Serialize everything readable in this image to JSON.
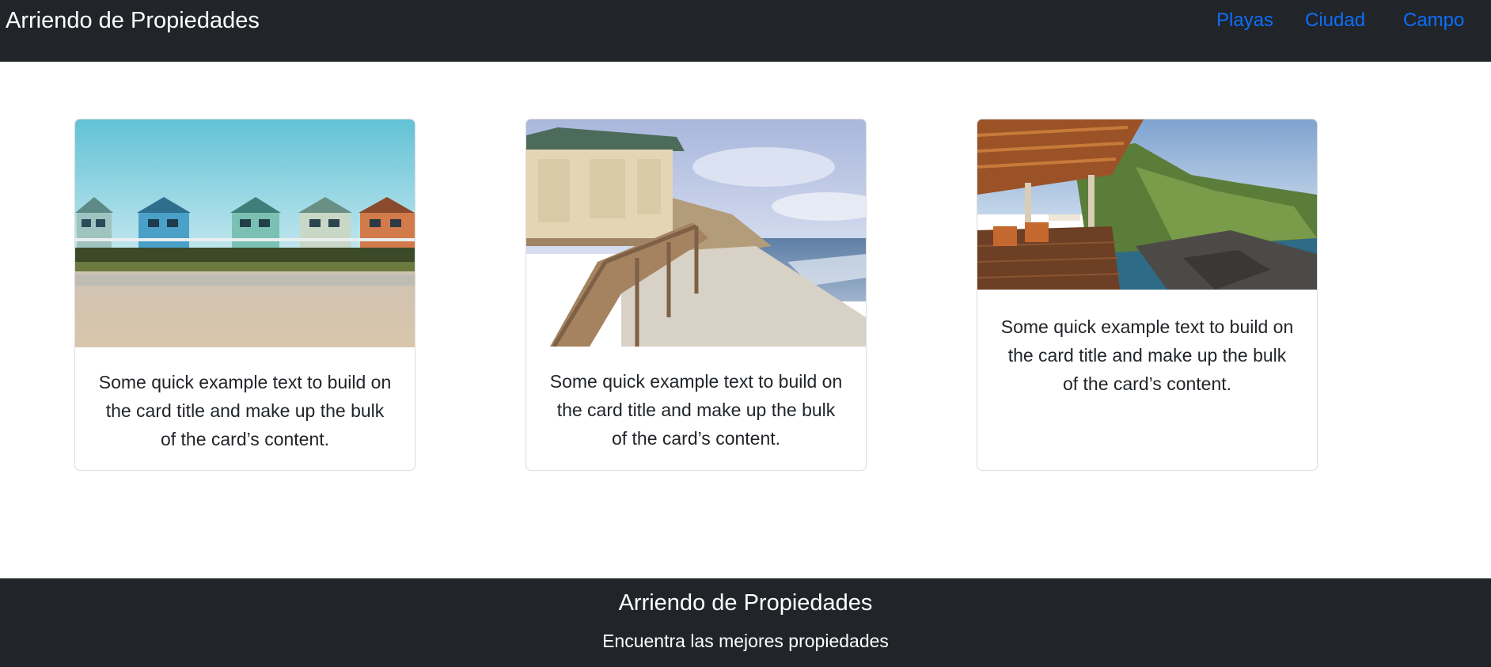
{
  "navbar": {
    "brand": "Arriendo de Propiedades",
    "links": [
      {
        "label": "Playas"
      },
      {
        "label": "Ciudad"
      },
      {
        "label": "Campo"
      }
    ]
  },
  "cards": [
    {
      "image": "beach-houses-photo",
      "text": "Some quick example text to build on the card title and make up the bulk of the card’s content."
    },
    {
      "image": "beach-cabin-stairs-photo",
      "text": "Some quick example text to build on the card title and make up the bulk of the card’s content."
    },
    {
      "image": "coastal-terrace-photo",
      "text": "Some quick example text to build on the card title and make up the bulk of the card’s content."
    }
  ],
  "footer": {
    "title": "Arriendo de Propiedades",
    "subtitle": "Encuentra las mejores propiedades"
  },
  "colors": {
    "navbar_bg": "#212529",
    "link": "#0d6efd",
    "text": "#212529",
    "card_border": "#dcdcdc"
  }
}
